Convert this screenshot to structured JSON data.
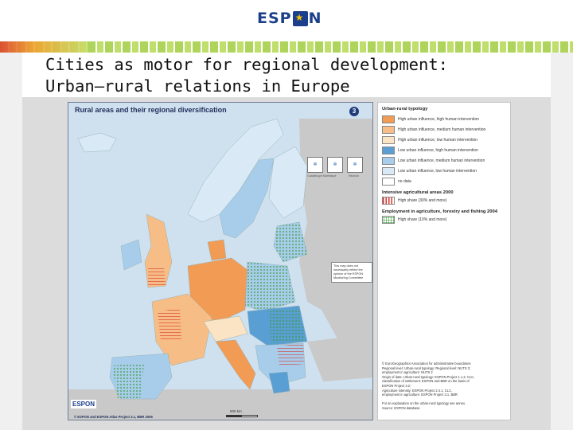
{
  "header": {
    "logo_text_left": "ESP",
    "logo_text_right": "N",
    "title_line1": "Cities as motor for regional development:",
    "title_line2": "Urban–rural relations in Europe"
  },
  "map": {
    "title": "Rural areas and their regional diversification",
    "badge": "3",
    "note": "This map does not necessarily reflect the opinion of the ESPON Monitoring Committee",
    "credit": "© ESPON and ESPON Atlas Project 3.1, BBR 2006",
    "scale_label": "500 km",
    "inset_labels": [
      "Guadeloupe Martinique",
      "Réunion"
    ],
    "mini_logo": "ESPON",
    "colors": {
      "sea": "#cfe0ef",
      "non_espon": "#c9c9c9",
      "high_urban_high": "#f29b55",
      "high_urban_medium": "#f7bd86",
      "high_urban_low": "#fbe4c4",
      "low_urban_high": "#5a9fd4",
      "low_urban_medium": "#a8cdea",
      "low_urban_low": "#d9e9f6"
    }
  },
  "legend": {
    "typology_heading": "Urban-rural typology",
    "items": [
      {
        "label": "High urban influence, high human intervention",
        "color": "#f29b55"
      },
      {
        "label": "High urban influence, medium human intervention",
        "color": "#f7bd86"
      },
      {
        "label": "High urban influence, low human intervention",
        "color": "#fbe4c4"
      },
      {
        "label": "Low urban influence, high human intervention",
        "color": "#5a9fd4"
      },
      {
        "label": "Low urban influence, medium human intervention",
        "color": "#a8cdea"
      },
      {
        "label": "Low urban influence, low human intervention",
        "color": "#d9e9f6"
      },
      {
        "label": "no data",
        "color": "#ffffff"
      }
    ],
    "agri_heading": "Intensive agricultural areas 2000",
    "agri_item": "High share (30% and more)",
    "emp_heading": "Employment in agriculture, forestry and fishing 2004",
    "emp_item": "High share (10% and more)",
    "sources": [
      "© EuroGeographics Association for administrative boundaries",
      "Regional level: Urban-rural typology: Regional level: NUTS 3;",
      "employment in agriculture: NUTS 2",
      "Origin of data: Urban-rural typology: ESPON Project 1.1.2; CLC,",
      "classification of settlement: ESPON and BBR on the basis of",
      "ESPON Project 3.2;",
      "Agriculture intensity: ESPON Project 2.4.1, CLC,",
      "employment in agriculture: ESPON Project 3.1, BBR",
      "",
      "For an explanation on the urban-rural typology see annex.",
      "Source: ESPON database"
    ]
  }
}
